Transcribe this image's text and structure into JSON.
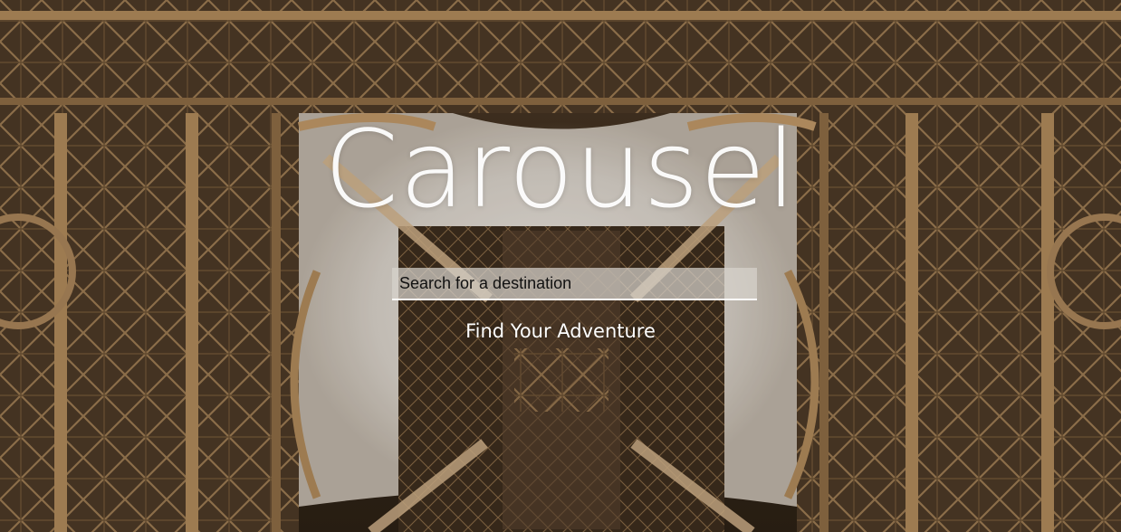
{
  "brand": {
    "title": "Carousel"
  },
  "search": {
    "placeholder": "Search for a destination",
    "value": ""
  },
  "cta": {
    "label": "Find Your Adventure"
  },
  "background": {
    "icon": "eiffel-tower-lattice-photo",
    "tones": [
      "#3a2b1c",
      "#8a6a46",
      "#e8e4de"
    ]
  }
}
